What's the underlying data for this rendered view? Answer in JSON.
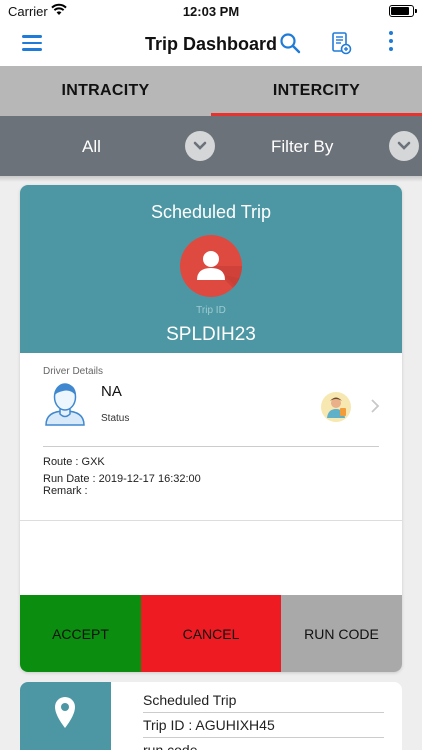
{
  "status_bar": {
    "carrier": "Carrier",
    "time": "12:03 PM"
  },
  "nav": {
    "title": "Trip Dashboard"
  },
  "tabs": [
    {
      "label": "INTRACITY",
      "active": false
    },
    {
      "label": "INTERCITY",
      "active": true
    }
  ],
  "filters": {
    "all_label": "All",
    "filter_by_label": "Filter By"
  },
  "trip_card": {
    "header_title": "Scheduled Trip",
    "trip_id_label": "Trip ID",
    "trip_id": "SPLDIH23",
    "driver_details_label": "Driver Details",
    "driver_name": "NA",
    "driver_status_label": "Status",
    "route": "Route : GXK",
    "run_date": "Run Date : 2019-12-17 16:32:00",
    "remark": "Remark :",
    "actions": {
      "accept": "ACCEPT",
      "cancel": "CANCEL",
      "run_code": "RUN CODE"
    }
  },
  "trip_card_2": {
    "title": "Scheduled Trip",
    "trip_id": "Trip ID : AGUHIXH45",
    "run_code": "run code"
  },
  "colors": {
    "nav_accent": "#1f7bd8",
    "card_header": "#4c97a3",
    "avatar_red": "#df4a40",
    "tab_underline": "#e8322e",
    "accept": "#0b8e0f",
    "cancel": "#ef1b23",
    "run_code": "#a9a9a9",
    "filter_bar": "#6c7279"
  }
}
